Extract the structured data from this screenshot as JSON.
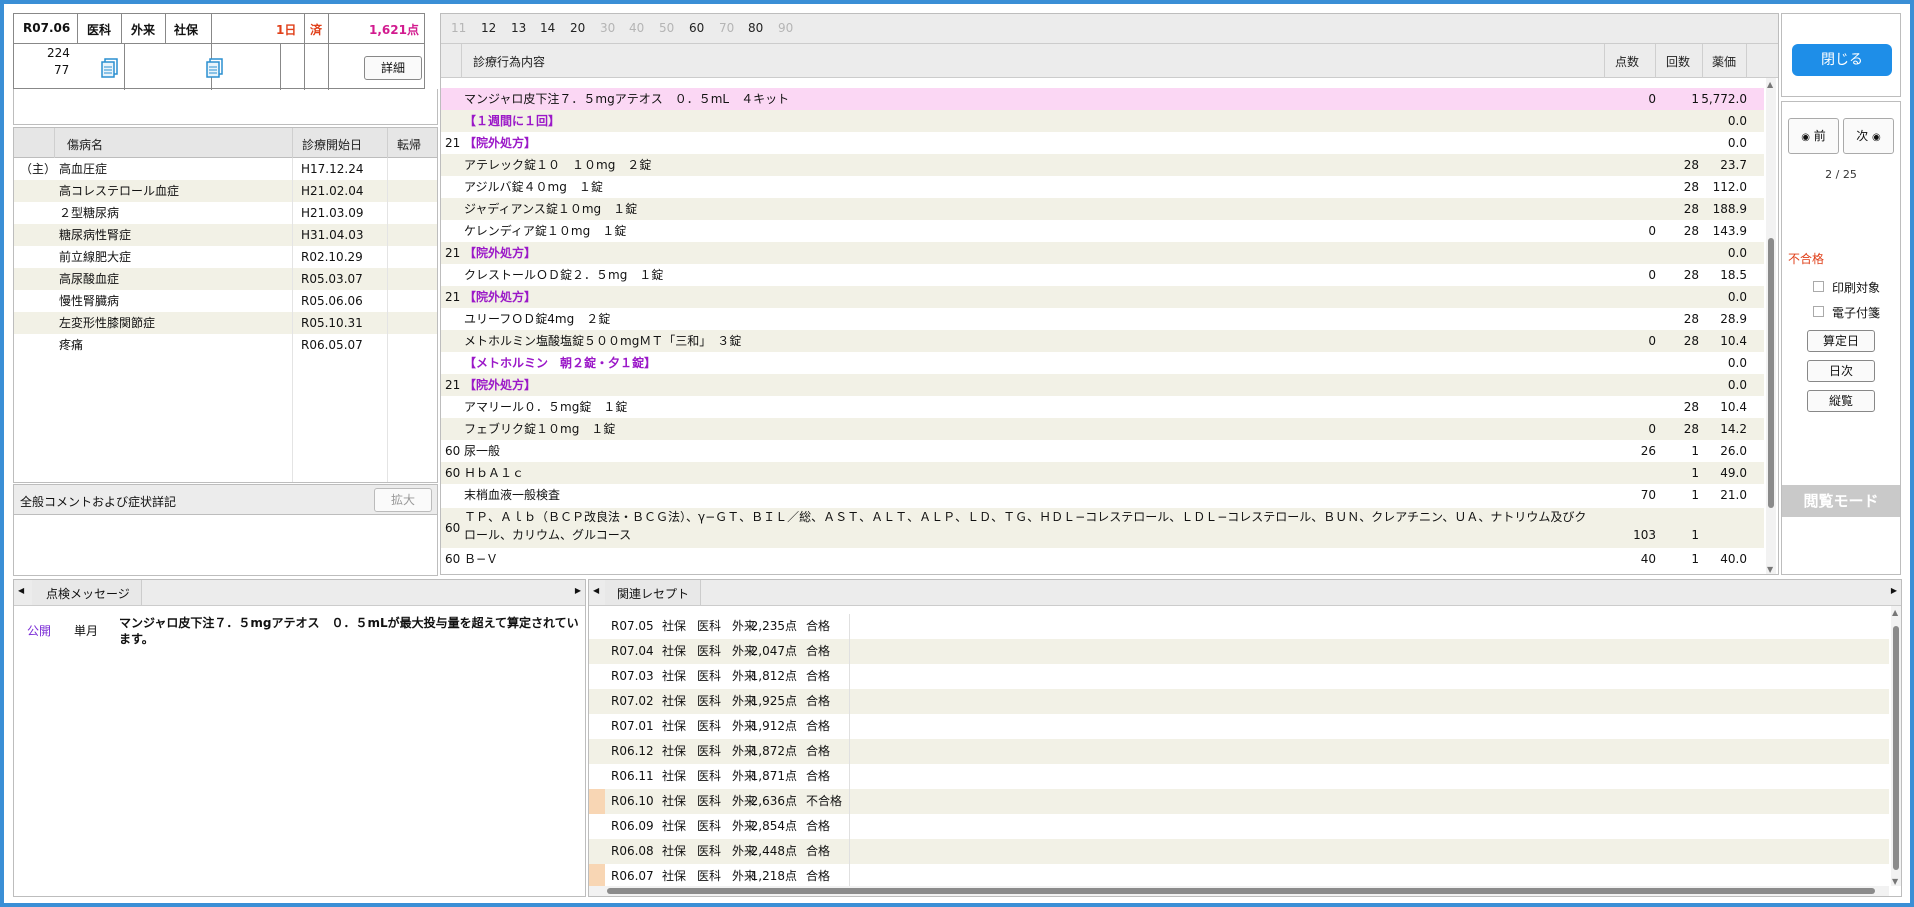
{
  "summary": {
    "era_date": "R07.06",
    "dept": "医科",
    "visit": "外来",
    "insurance": "社保",
    "days": "1日",
    "status": "済",
    "points": "1,621点",
    "row2_a": "224",
    "row2_b": "77",
    "detail_button": "詳細"
  },
  "disease": {
    "headers": [
      "傷病名",
      "診療開始日",
      "転帰"
    ],
    "rows": [
      {
        "mark": "（主）",
        "name": "高血圧症",
        "date": "H17.12.24"
      },
      {
        "mark": "",
        "name": "高コレステロール血症",
        "date": "H21.02.04"
      },
      {
        "mark": "",
        "name": "２型糖尿病",
        "date": "H21.03.09"
      },
      {
        "mark": "",
        "name": "糖尿病性腎症",
        "date": "H31.04.03"
      },
      {
        "mark": "",
        "name": "前立線肥大症",
        "date": "R02.10.29"
      },
      {
        "mark": "",
        "name": "高尿酸血症",
        "date": "R05.03.07"
      },
      {
        "mark": "",
        "name": "慢性腎臓病",
        "date": "R05.06.06"
      },
      {
        "mark": "",
        "name": "左変形性膝関節症",
        "date": "R05.10.31"
      },
      {
        "mark": "",
        "name": "疼痛",
        "date": "R06.05.07"
      }
    ]
  },
  "comment": {
    "title": "全般コメントおよび症状詳記",
    "expand_label": "拡大"
  },
  "codes": {
    "items": [
      {
        "t": "11",
        "active": false
      },
      {
        "t": "12",
        "active": true
      },
      {
        "t": "13",
        "active": true
      },
      {
        "t": "14",
        "active": true
      },
      {
        "t": "20",
        "active": true
      },
      {
        "t": "30",
        "active": false
      },
      {
        "t": "40",
        "active": false
      },
      {
        "t": "50",
        "active": false
      },
      {
        "t": "60",
        "active": true
      },
      {
        "t": "70",
        "active": false
      },
      {
        "t": "80",
        "active": true
      },
      {
        "t": "90",
        "active": false
      }
    ]
  },
  "treatments": {
    "headers": {
      "content": "診療行為内容",
      "points": "点数",
      "count": "回数",
      "price": "薬価"
    },
    "rows": [
      {
        "code": "",
        "text": "マンジャロ皮下注７．５mgアテオス　０．５mL　４キット",
        "points": "0",
        "count": "1",
        "price": "5,772.0",
        "style": "pink"
      },
      {
        "code": "",
        "text": "【１週間に１回】",
        "points": "",
        "count": "",
        "price": "0.0",
        "style": "purple"
      },
      {
        "code": "21",
        "text": "【院外処方】",
        "points": "",
        "count": "",
        "price": "0.0",
        "style": "purple"
      },
      {
        "code": "",
        "text": "アテレック錠１０　１０mg　２錠",
        "points": "",
        "count": "28",
        "price": "23.7",
        "style": ""
      },
      {
        "code": "",
        "text": "アジルバ錠４０mg　１錠",
        "points": "",
        "count": "28",
        "price": "112.0",
        "style": ""
      },
      {
        "code": "",
        "text": "ジャディアンス錠１０mg　１錠",
        "points": "",
        "count": "28",
        "price": "188.9",
        "style": ""
      },
      {
        "code": "",
        "text": "ケレンディア錠１０mg　１錠",
        "points": "0",
        "count": "28",
        "price": "143.9",
        "style": ""
      },
      {
        "code": "21",
        "text": "【院外処方】",
        "points": "",
        "count": "",
        "price": "0.0",
        "style": "purple"
      },
      {
        "code": "",
        "text": "クレストールＯＤ錠２．５mg　１錠",
        "points": "0",
        "count": "28",
        "price": "18.5",
        "style": ""
      },
      {
        "code": "21",
        "text": "【院外処方】",
        "points": "",
        "count": "",
        "price": "0.0",
        "style": "purple"
      },
      {
        "code": "",
        "text": "ユリーフＯＤ錠4mg　２錠",
        "points": "",
        "count": "28",
        "price": "28.9",
        "style": ""
      },
      {
        "code": "",
        "text": "メトホルミン塩酸塩錠５００mgＭＴ「三和」　３錠",
        "points": "0",
        "count": "28",
        "price": "10.4",
        "style": ""
      },
      {
        "code": "",
        "text": "【メトホルミン　朝２錠・夕１錠】",
        "points": "",
        "count": "",
        "price": "0.0",
        "style": "purple"
      },
      {
        "code": "21",
        "text": "【院外処方】",
        "points": "",
        "count": "",
        "price": "0.0",
        "style": "purple"
      },
      {
        "code": "",
        "text": "アマリール０．５mg錠　１錠",
        "points": "",
        "count": "28",
        "price": "10.4",
        "style": ""
      },
      {
        "code": "",
        "text": "フェブリク錠１０mg　１錠",
        "points": "0",
        "count": "28",
        "price": "14.2",
        "style": ""
      },
      {
        "code": "60",
        "text": "尿一般",
        "points": "26",
        "count": "1",
        "price": "26.0",
        "style": ""
      },
      {
        "code": "60",
        "text": "ＨｂＡ１ｃ",
        "points": "",
        "count": "1",
        "price": "49.0",
        "style": ""
      },
      {
        "code": "",
        "text": "末梢血液一般検査",
        "points": "70",
        "count": "1",
        "price": "21.0",
        "style": ""
      }
    ],
    "long_row": {
      "code": "60",
      "line1": "ＴＰ、Ａｌｂ（ＢＣＰ改良法・ＢＣＧ法）、γ−ＧＴ、ＢＩＬ／総、ＡＳＴ、ＡＬＴ、ＡＬＰ、ＬＤ、ＴＧ、ＨＤＬ−コレステロール、ＬＤＬ−コレステロール、ＢＵＮ、クレアチニン、ＵＡ、ナトリウム及びク",
      "line2": "ロール、カリウム、グルコース",
      "points": "103",
      "count": "1",
      "price": ""
    },
    "last_row": {
      "code": "60",
      "text": "Ｂ−Ｖ",
      "points": "40",
      "count": "1",
      "price": "40.0"
    }
  },
  "side": {
    "close_label": "閉じる",
    "prev_label": "前",
    "next_label": "次",
    "page": "2 / 25",
    "fail_label": "不合格",
    "print_label": "印刷対象",
    "sticky_label": "電子付箋",
    "calc_day_label": "算定日",
    "daily_label": "日次",
    "vertical_label": "縦覧",
    "mode_label": "閲覧モード"
  },
  "messages": {
    "title": "点検メッセージ",
    "rows": [
      {
        "scope": "公開",
        "period": "単月",
        "text1": "マンジャロ皮下注７．５mgアテオス　０．５mLが最大投与量を超えて算定されてい",
        "text2": "ます。"
      }
    ]
  },
  "related": {
    "title": "関連レセプト",
    "rows": [
      {
        "month": "R07.05",
        "ins": "社保",
        "dept": "医科",
        "visit": "外来",
        "points": "2,235点",
        "result": "合格",
        "flag": false
      },
      {
        "month": "R07.04",
        "ins": "社保",
        "dept": "医科",
        "visit": "外来",
        "points": "2,047点",
        "result": "合格",
        "flag": false
      },
      {
        "month": "R07.03",
        "ins": "社保",
        "dept": "医科",
        "visit": "外来",
        "points": "1,812点",
        "result": "合格",
        "flag": false
      },
      {
        "month": "R07.02",
        "ins": "社保",
        "dept": "医科",
        "visit": "外来",
        "points": "1,925点",
        "result": "合格",
        "flag": false
      },
      {
        "month": "R07.01",
        "ins": "社保",
        "dept": "医科",
        "visit": "外来",
        "points": "1,912点",
        "result": "合格",
        "flag": false
      },
      {
        "month": "R06.12",
        "ins": "社保",
        "dept": "医科",
        "visit": "外来",
        "points": "1,872点",
        "result": "合格",
        "flag": false
      },
      {
        "month": "R06.11",
        "ins": "社保",
        "dept": "医科",
        "visit": "外来",
        "points": "1,871点",
        "result": "合格",
        "flag": false
      },
      {
        "month": "R06.10",
        "ins": "社保",
        "dept": "医科",
        "visit": "外来",
        "points": "2,636点",
        "result": "不合格",
        "flag": true
      },
      {
        "month": "R06.09",
        "ins": "社保",
        "dept": "医科",
        "visit": "外来",
        "points": "2,854点",
        "result": "合格",
        "flag": false
      },
      {
        "month": "R06.08",
        "ins": "社保",
        "dept": "医科",
        "visit": "外来",
        "points": "2,448点",
        "result": "合格",
        "flag": false
      },
      {
        "month": "R06.07",
        "ins": "社保",
        "dept": "医科",
        "visit": "外来",
        "points": "1,218点",
        "result": "合格",
        "flag": true
      }
    ]
  },
  "colors": {
    "accent": "#1e8ee8",
    "pink_row": "#fbd7f4",
    "alt_row": "#f2f1e6",
    "purple": "#9b18c8",
    "fail": "#e0401a"
  }
}
